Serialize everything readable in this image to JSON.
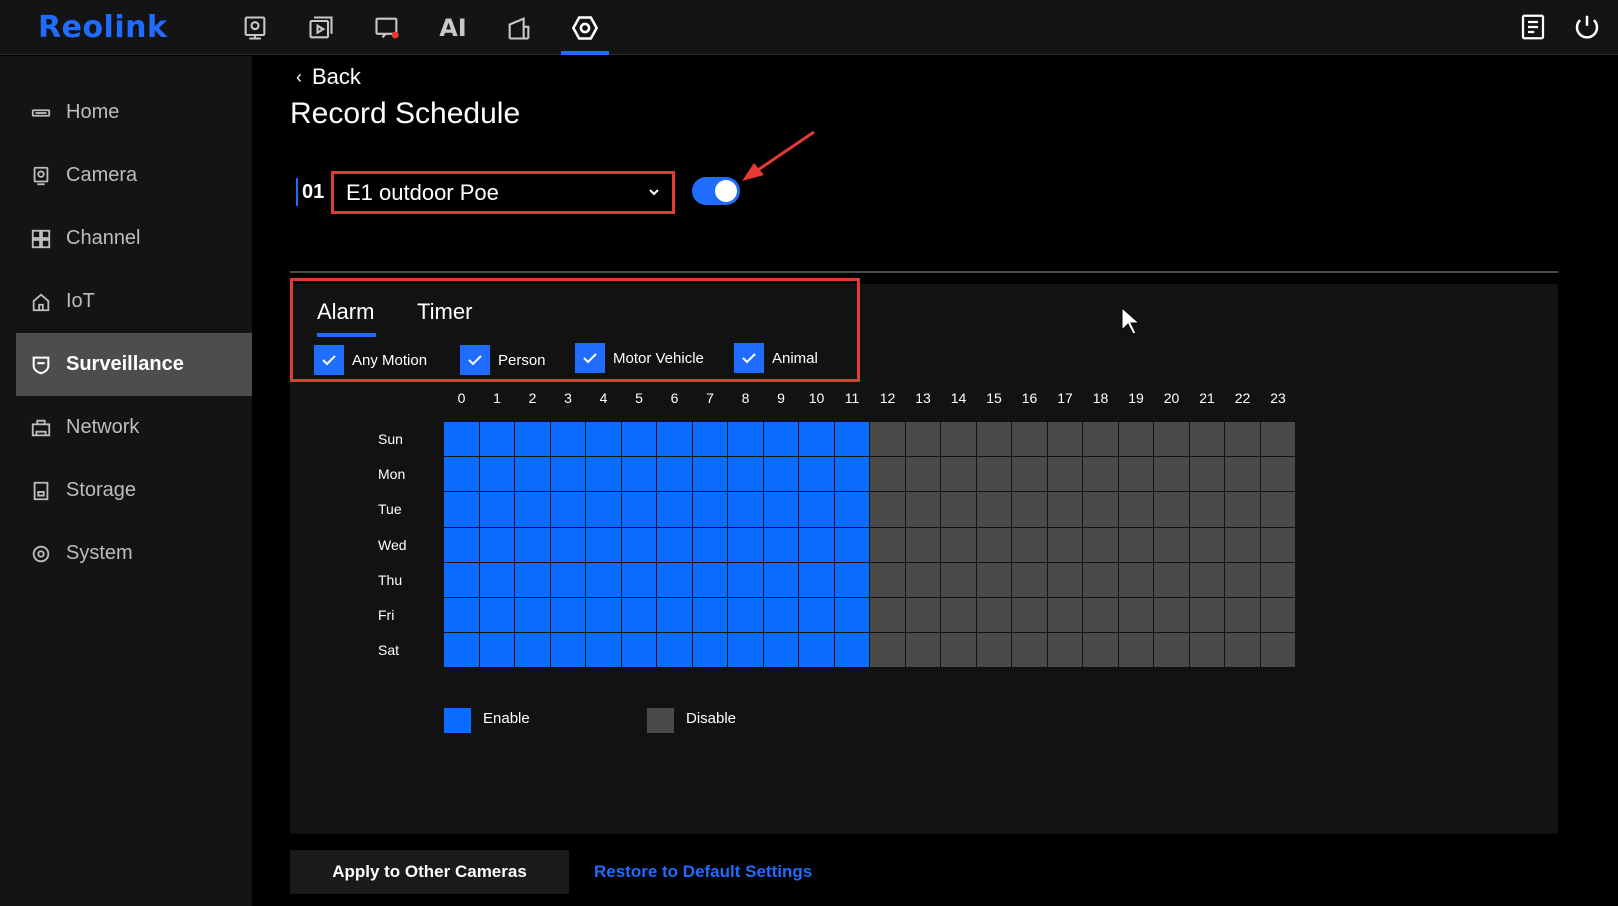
{
  "app": {
    "logo": "Reolink"
  },
  "topnav": [
    {
      "name": "live-view-icon"
    },
    {
      "name": "playback-icon"
    },
    {
      "name": "alerts-icon"
    },
    {
      "name": "ai",
      "label": "AI"
    },
    {
      "name": "devices-icon"
    },
    {
      "name": "settings-icon",
      "active": true
    }
  ],
  "top_right": {
    "notes_icon": "notes-icon",
    "power_icon": "power-icon"
  },
  "sidebar": {
    "items": [
      {
        "label": "Home",
        "icon": "home-icon"
      },
      {
        "label": "Camera",
        "icon": "camera-icon"
      },
      {
        "label": "Channel",
        "icon": "channel-icon"
      },
      {
        "label": "IoT",
        "icon": "iot-icon"
      },
      {
        "label": "Surveillance",
        "icon": "shield-icon",
        "active": true
      },
      {
        "label": "Network",
        "icon": "network-icon"
      },
      {
        "label": "Storage",
        "icon": "storage-icon"
      },
      {
        "label": "System",
        "icon": "system-icon"
      }
    ]
  },
  "header": {
    "back_label": "Back",
    "title": "Record Schedule"
  },
  "camera": {
    "channel": "01",
    "name": "E1 outdoor Poe",
    "enabled": true
  },
  "tabs": [
    {
      "label": "Alarm",
      "active": true
    },
    {
      "label": "Timer",
      "active": false
    }
  ],
  "filters": [
    {
      "label": "Any Motion",
      "checked": true
    },
    {
      "label": "Person",
      "checked": true
    },
    {
      "label": "Motor Vehicle",
      "checked": true
    },
    {
      "label": "Animal",
      "checked": true
    }
  ],
  "schedule": {
    "hours": [
      "0",
      "1",
      "2",
      "3",
      "4",
      "5",
      "6",
      "7",
      "8",
      "9",
      "10",
      "11",
      "12",
      "13",
      "14",
      "15",
      "16",
      "17",
      "18",
      "19",
      "20",
      "21",
      "22",
      "23"
    ],
    "days": [
      "Sun",
      "Mon",
      "Tue",
      "Wed",
      "Thu",
      "Fri",
      "Sat"
    ],
    "enabled_hours": [
      0,
      1,
      2,
      3,
      4,
      5,
      6,
      7,
      8,
      9,
      10,
      11
    ]
  },
  "legend": {
    "enable": "Enable",
    "disable": "Disable"
  },
  "colors": {
    "accent": "#1f6cff",
    "enabled_cell": "#0a6dff",
    "disabled_cell": "#4a4a4a",
    "highlight": "#e53935"
  },
  "footer": {
    "apply_label": "Apply to Other Cameras",
    "restore_label": "Restore to Default Settings"
  }
}
